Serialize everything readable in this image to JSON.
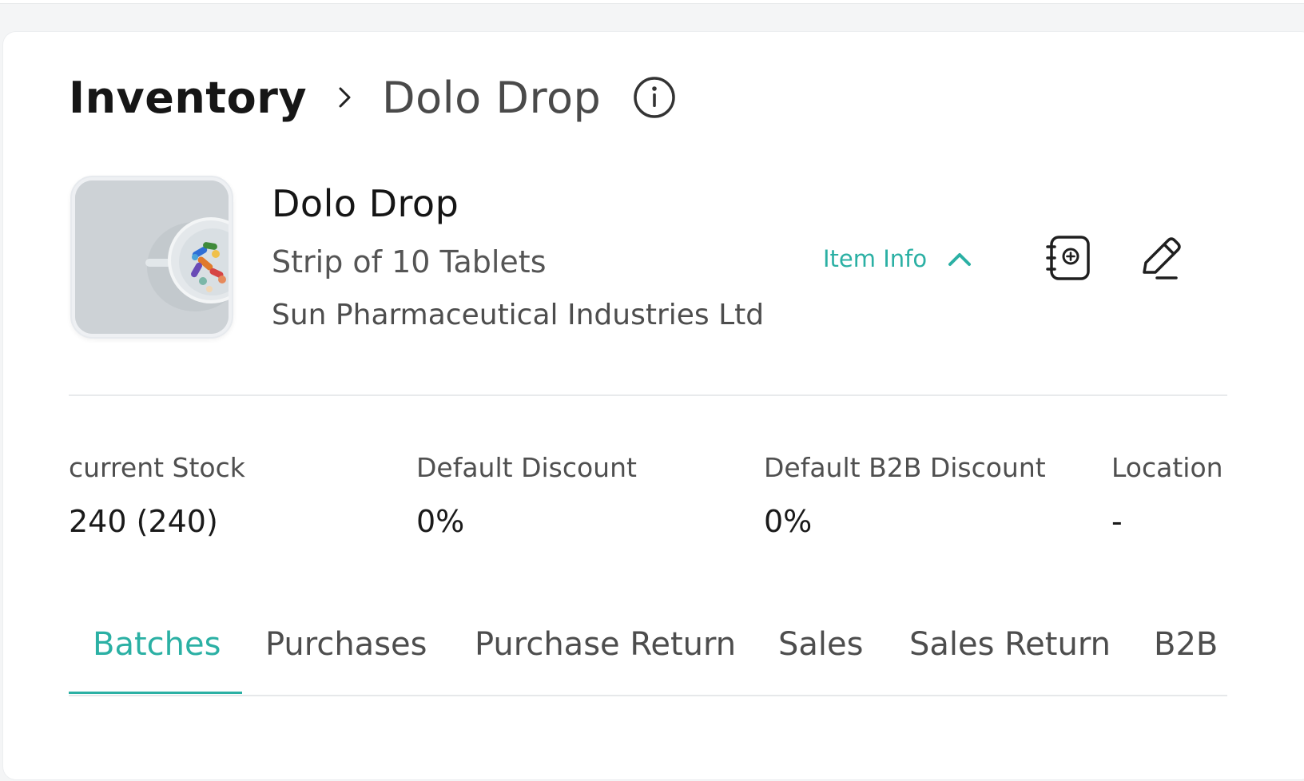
{
  "breadcrumb": {
    "root": "Inventory",
    "current": "Dolo Drop"
  },
  "product": {
    "name": "Dolo Drop",
    "pack": "Strip of 10 Tablets",
    "manufacturer": "Sun Pharmaceutical Industries Ltd"
  },
  "item_info": {
    "label": "Item Info"
  },
  "stats": [
    {
      "label": "current Stock",
      "value": "240 (240)"
    },
    {
      "label": "Default Discount",
      "value": "0%"
    },
    {
      "label": "Default B2B Discount",
      "value": "0%"
    },
    {
      "label": "Location",
      "value": "-"
    }
  ],
  "tabs": [
    {
      "label": "Batches",
      "active": true
    },
    {
      "label": "Purchases"
    },
    {
      "label": "Purchase Return"
    },
    {
      "label": "Sales"
    },
    {
      "label": "Sales Return"
    },
    {
      "label": "B2B"
    }
  ],
  "icons": {
    "info": "info-circle-icon",
    "chevron_right": "chevron-right-icon",
    "chevron_up": "chevron-up-icon",
    "notebook_add": "notebook-add-icon",
    "edit": "pencil-icon"
  },
  "colors": {
    "accent": "#2bb0a4",
    "text_dark": "#161616",
    "text_muted": "#4f4f4f"
  }
}
